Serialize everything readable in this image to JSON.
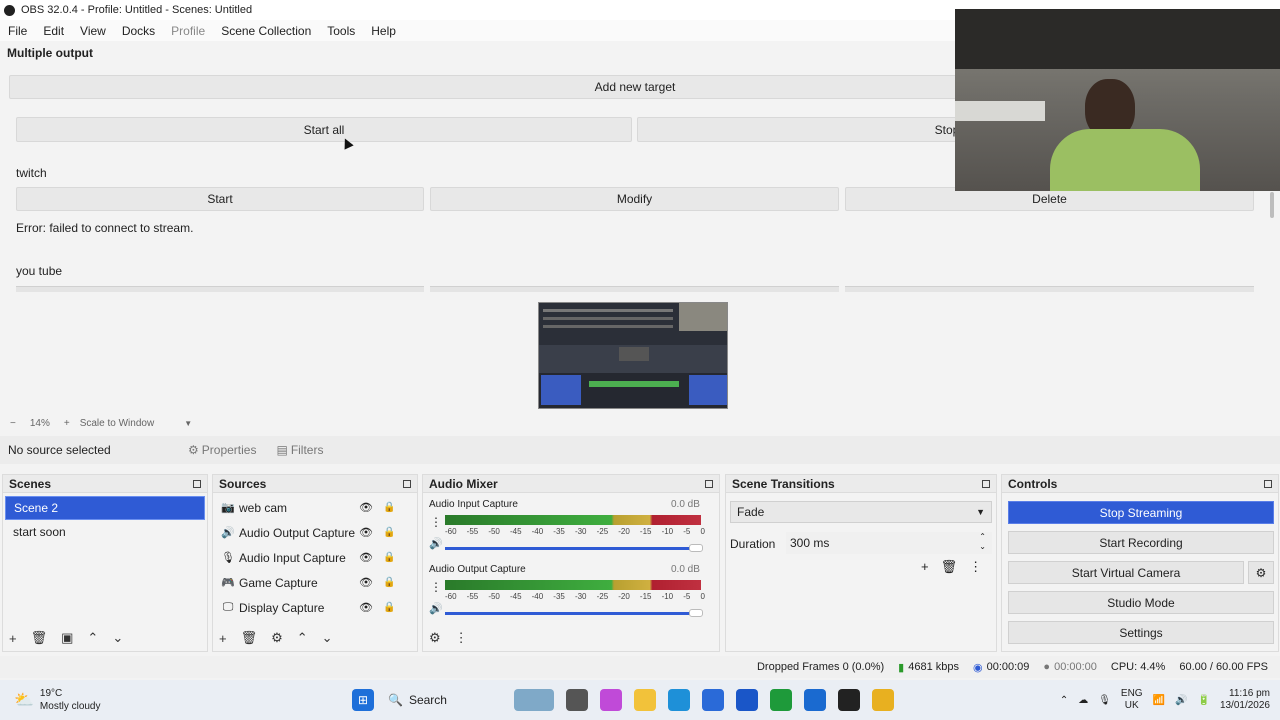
{
  "window": {
    "title": "OBS 32.0.4 - Profile: Untitled - Scenes: Untitled"
  },
  "menu": [
    "File",
    "Edit",
    "View",
    "Docks",
    "Profile",
    "Scene Collection",
    "Tools",
    "Help"
  ],
  "multiple_output": {
    "title": "Multiple output",
    "add_target": "Add new target",
    "start_all": "Start all",
    "stop_all": "Stop",
    "targets": [
      {
        "name": "twitch",
        "start": "Start",
        "modify": "Modify",
        "delete": "Delete",
        "error": "Error: failed to connect to stream."
      },
      {
        "name": "you tube"
      }
    ]
  },
  "preview": {
    "zoom": "14%",
    "scale_mode": "Scale to Window"
  },
  "source_bar": {
    "no_source": "No source selected",
    "properties": "Properties",
    "filters": "Filters"
  },
  "scenes": {
    "title": "Scenes",
    "items": [
      "Scene 2",
      "start soon"
    ],
    "selected": "Scene 2"
  },
  "sources": {
    "title": "Sources",
    "items": [
      {
        "name": "web cam",
        "icon": "camera-icon"
      },
      {
        "name": "Audio Output Capture",
        "icon": "speaker-icon"
      },
      {
        "name": "Audio Input Capture",
        "icon": "microphone-icon"
      },
      {
        "name": "Game Capture",
        "icon": "gamepad-icon"
      },
      {
        "name": "Display Capture",
        "icon": "monitor-icon"
      }
    ]
  },
  "audio_mixer": {
    "title": "Audio Mixer",
    "channels": [
      {
        "name": "Audio Input Capture",
        "level": "0.0 dB"
      },
      {
        "name": "Audio Output Capture",
        "level": "0.0 dB"
      }
    ],
    "ticks": [
      "-60",
      "-55",
      "-50",
      "-45",
      "-40",
      "-35",
      "-30",
      "-25",
      "-20",
      "-15",
      "-10",
      "-5",
      "0"
    ]
  },
  "scene_transitions": {
    "title": "Scene Transitions",
    "transition": "Fade",
    "duration_label": "Duration",
    "duration_value": "300 ms"
  },
  "controls": {
    "title": "Controls",
    "stop_streaming": "Stop Streaming",
    "start_recording": "Start Recording",
    "start_virtual_camera": "Start Virtual Camera",
    "studio_mode": "Studio Mode",
    "settings": "Settings"
  },
  "status": {
    "dropped": "Dropped Frames 0 (0.0%)",
    "bitrate": "4681 kbps",
    "stream_time": "00:00:09",
    "rec_time": "00:00:00",
    "cpu": "CPU: 4.4%",
    "fps": "60.00 / 60.00 FPS"
  },
  "taskbar": {
    "weather_temp": "19°C",
    "weather_desc": "Mostly cloudy",
    "search": "Search",
    "lang1": "ENG",
    "lang2": "UK",
    "time": "11:16 pm",
    "date": "13/01/2026"
  },
  "colors": {
    "accent": "#2f5bd5",
    "meter_green": "#3fae3f",
    "meter_yellow": "#d0b040",
    "meter_red": "#c03040"
  }
}
